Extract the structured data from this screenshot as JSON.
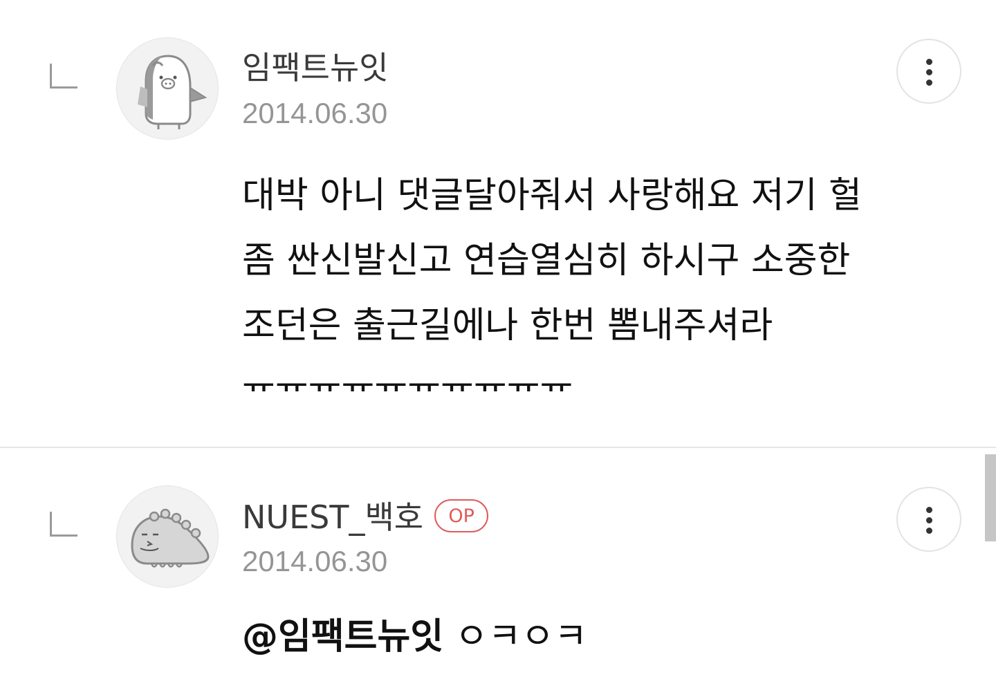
{
  "comments": [
    {
      "author": "임팩트뉴잇",
      "date": "2014.06.30",
      "avatar_icon": "penguin-avatar-icon",
      "is_op": false,
      "body": "대박 아니 댓글달아줘서 사랑해요 저기 헐 좀 싼신발신고 연습열심히 하시구 소중한 조던은 출근길에나 한번 뽐내주셔라 ㅠㅠㅠㅠㅠㅠㅠㅠㅠㅠ",
      "more_icon": "more-vertical-icon"
    },
    {
      "author": "NUEST_백호",
      "op_label": "OP",
      "date": "2014.06.30",
      "avatar_icon": "dinosaur-avatar-icon",
      "is_op": true,
      "mention": "@임팩트뉴잇",
      "body": " ㅇㅋㅇㅋ",
      "more_icon": "more-vertical-icon"
    }
  ],
  "colors": {
    "op_badge": "#e05a5a",
    "date": "#959595",
    "author": "#3a3a3a",
    "divider": "#e6e6e6"
  }
}
